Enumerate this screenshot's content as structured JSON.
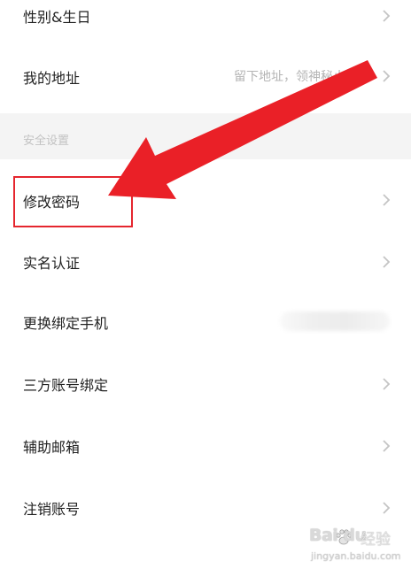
{
  "items": {
    "gender_birthday": {
      "label": "性别&生日"
    },
    "address": {
      "label": "我的地址",
      "hint": "留下地址，领神秘小礼物"
    },
    "change_password": {
      "label": "修改密码"
    },
    "real_name": {
      "label": "实名认证"
    },
    "change_phone": {
      "label": "更换绑定手机"
    },
    "third_party": {
      "label": "三方账号绑定"
    },
    "backup_email": {
      "label": "辅助邮箱"
    },
    "deactivate": {
      "label": "注销账号"
    }
  },
  "section": {
    "security_title": "安全设置"
  },
  "annotation": {
    "highlight_color": "#e5262e",
    "arrow_color": "#ea2027"
  },
  "watermark": {
    "brand": "Bai du",
    "product": "经验",
    "url": "jingyan.baidu.com"
  },
  "icons": {
    "chevron": "chevron-right-icon"
  }
}
